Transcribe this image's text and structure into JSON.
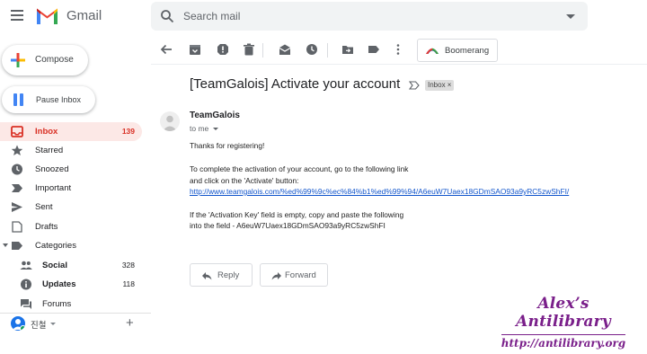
{
  "app": {
    "name": "Gmail"
  },
  "search": {
    "placeholder": "Search mail"
  },
  "sidebar": {
    "compose_label": "Compose",
    "pause_label": "Pause Inbox",
    "items": [
      {
        "label": "Inbox",
        "count": "139",
        "icon": "inbox-icon"
      },
      {
        "label": "Starred",
        "count": "",
        "icon": "star-icon"
      },
      {
        "label": "Snoozed",
        "count": "",
        "icon": "clock-icon"
      },
      {
        "label": "Important",
        "count": "",
        "icon": "important-icon"
      },
      {
        "label": "Sent",
        "count": "",
        "icon": "send-icon"
      },
      {
        "label": "Drafts",
        "count": "",
        "icon": "drafts-icon"
      },
      {
        "label": "Categories",
        "count": "",
        "icon": "label-icon"
      },
      {
        "label": "Social",
        "count": "328",
        "icon": "people-icon"
      },
      {
        "label": "Updates",
        "count": "118",
        "icon": "info-icon"
      },
      {
        "label": "Forums",
        "count": "",
        "icon": "forum-icon"
      }
    ],
    "user_name": "진철"
  },
  "toolbar": {
    "boomerang_label": "Boomerang",
    "icons": [
      "back-arrow-icon",
      "archive-icon",
      "report-spam-icon",
      "delete-icon",
      "mark-unread-icon",
      "snooze-icon",
      "move-to-icon",
      "labels-icon",
      "more-vert-icon"
    ]
  },
  "message": {
    "subject": "[TeamGalois] Activate your account",
    "label_chip": "Inbox ×",
    "sender": "TeamGalois",
    "to": "to me",
    "body": {
      "greeting": "Thanks for registering!",
      "line1": "To complete the activation of your account, go to the following link",
      "line2": "and click on the 'Activate' button:",
      "link": "http://www.teamgalois.com/%ed%99%9c%ec%84%b1%ed%99%94/A6euW7Uaex18GDmSAO93a9yRC5zwShFI/",
      "line3": "If the 'Activation Key' field is empty, copy and paste the following",
      "line4": "into the field - A6euW7Uaex18GDmSAO93a9yRC5zwShFI"
    },
    "reply_label": "Reply",
    "forward_label": "Forward"
  },
  "watermark": {
    "line1": "Alex’s Antilibrary",
    "line2": "http://antilibrary.org"
  },
  "colors": {
    "gmail_red": "#d93025",
    "accent_blue": "#1a73e8",
    "link": "#1155cc",
    "watermark": "#7a1f8a"
  }
}
